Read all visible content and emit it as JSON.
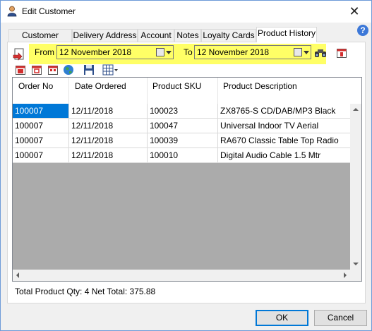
{
  "window": {
    "title": "Edit Customer",
    "close_glyph": "✕",
    "help_glyph": "?"
  },
  "tabs": [
    {
      "label": "Customer Details"
    },
    {
      "label": "Delivery Address"
    },
    {
      "label": "Account"
    },
    {
      "label": "Notes"
    },
    {
      "label": "Loyalty Cards"
    },
    {
      "label": "Product History",
      "active": true
    }
  ],
  "filter": {
    "from_label": "From",
    "from_value": "12 November 2018",
    "to_label": "To",
    "to_value": "12 November 2018"
  },
  "toolbar_icons": [
    "bookmark-icon",
    "calendar-today-icon",
    "calendar-icon",
    "calendar-month-icon",
    "calendar-range-icon",
    "globe-icon",
    "save-icon",
    "grid-layout-icon",
    "binoculars-icon",
    "calendar-single-icon"
  ],
  "grid": {
    "columns": [
      "Order No",
      "Date Ordered",
      "Product SKU",
      "Product Description"
    ],
    "rows": [
      [
        "100007",
        "12/11/2018",
        "100023",
        "ZX8765-S CD/DAB/MP3 Black"
      ],
      [
        "100007",
        "12/11/2018",
        "100047",
        "Universal Indoor TV Aerial"
      ],
      [
        "100007",
        "12/11/2018",
        "100039",
        "RA670 Classic Table Top Radio"
      ],
      [
        "100007",
        "12/11/2018",
        "100010",
        "Digital Audio Cable 1.5 Mtr"
      ]
    ]
  },
  "totals": {
    "text": "Total Product Qty: 4  Net Total: 375.88"
  },
  "buttons": {
    "ok": "OK",
    "cancel": "Cancel"
  },
  "colors": {
    "highlight": "#ffff66",
    "selection": "#0078d7",
    "grid_bg": "#ababab"
  }
}
